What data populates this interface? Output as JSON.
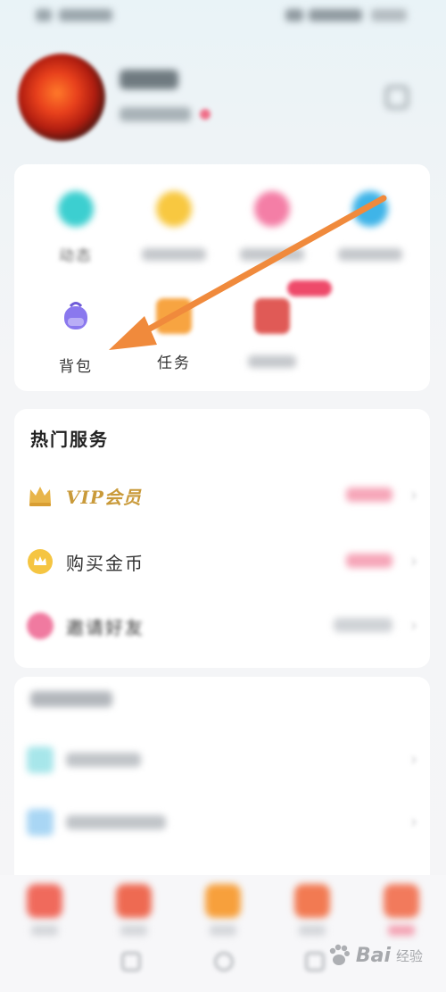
{
  "status_bar": {
    "left_text": "",
    "right_text": ""
  },
  "profile": {
    "name": "",
    "subtitle": ""
  },
  "grid": {
    "items": [
      {
        "label": "动态",
        "icon": "dynamic-icon",
        "color": "#3ccfd0"
      },
      {
        "label": "",
        "icon": "heart-badge-icon",
        "color": "#f8c840"
      },
      {
        "label": "",
        "icon": "gift-bag-icon",
        "color": "#f47ea6"
      },
      {
        "label": "",
        "icon": "chat-bubble-icon",
        "color": "#3fb4e8"
      },
      {
        "label": "背包",
        "icon": "backpack-icon",
        "color": "#8a78ee"
      },
      {
        "label": "任务",
        "icon": "task-icon",
        "color": "#f7a441"
      },
      {
        "label": "",
        "icon": "treasure-box-icon",
        "color": "#e05a56"
      }
    ]
  },
  "hot_services": {
    "title": "热门服务",
    "rows": [
      {
        "label": "VIP会员",
        "icon": "crown-icon",
        "value_color": "#f6a5b8"
      },
      {
        "label": "购买金币",
        "icon": "coin-icon",
        "value_color": "#f6a5b8"
      },
      {
        "label": "邀请好友",
        "icon": "invite-icon",
        "value_color": "#cfd2d6"
      }
    ]
  },
  "more_section": {
    "title": "",
    "rows": [
      {
        "label": "",
        "icon": "tile-icon",
        "color": "#a7e6ea"
      },
      {
        "label": "",
        "icon": "tile-icon",
        "color": "#a9d6f4"
      }
    ]
  },
  "watermark": {
    "brand": "Bai",
    "suffix": "经验"
  },
  "colors": {
    "accent_arrow": "#f08a3c",
    "vip_gold": "#c99a3a"
  }
}
